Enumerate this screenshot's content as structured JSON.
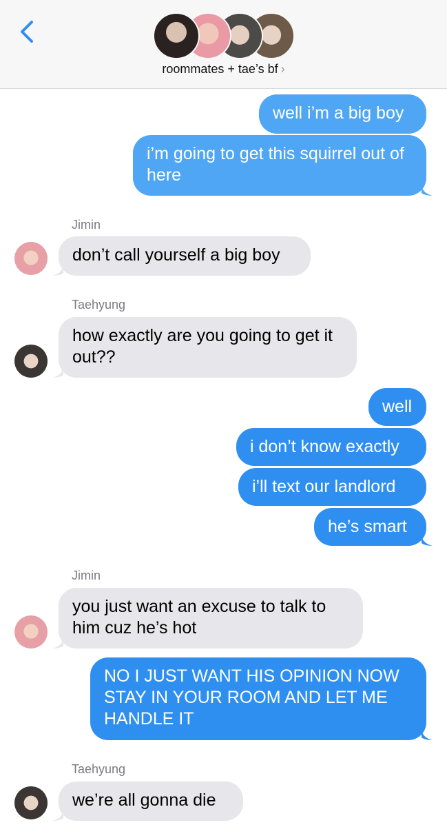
{
  "header": {
    "group_name": "roommates + tae’s bf",
    "chevron": "›"
  },
  "messages": [
    {
      "id": "m1",
      "sender": "",
      "text": "well i’m a big boy"
    },
    {
      "id": "m2",
      "sender": "",
      "text": "i’m going to get this squirrel out of here"
    },
    {
      "id": "m3",
      "sender": "Jimin",
      "text": "don’t call yourself a big boy"
    },
    {
      "id": "m4",
      "sender": "Taehyung",
      "text": "how exactly are you going to get it out??"
    },
    {
      "id": "m5",
      "sender": "",
      "text": "well"
    },
    {
      "id": "m6",
      "sender": "",
      "text": "i don’t know exactly"
    },
    {
      "id": "m7",
      "sender": "",
      "text": "i’ll text our landlord"
    },
    {
      "id": "m8",
      "sender": "",
      "text": "he’s smart"
    },
    {
      "id": "m9",
      "sender": "Jimin",
      "text": "you just want an excuse to talk to him cuz he’s hot"
    },
    {
      "id": "m10",
      "sender": "",
      "text": "NO I JUST WANT HIS OPINION NOW STAY IN YOUR ROOM AND LET ME HANDLE IT"
    },
    {
      "id": "m11",
      "sender": "Taehyung",
      "text": "we’re all gonna die"
    }
  ],
  "labels": {
    "jimin_1": "Jimin",
    "taehyung_1": "Taehyung",
    "jimin_2": "Jimin",
    "taehyung_2": "Taehyung"
  },
  "colors": {
    "accent": "#2f8ff0",
    "sent_bubble": "#2f8ff0",
    "received_bubble": "#e6e6eb"
  },
  "icons": {
    "back": "chevron-left-icon",
    "group_chevron": "chevron-right-icon"
  }
}
